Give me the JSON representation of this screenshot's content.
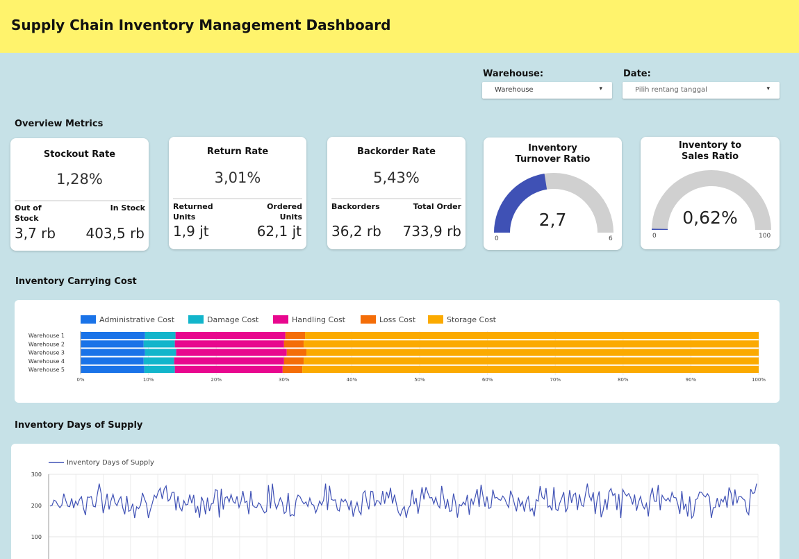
{
  "header": {
    "title": "Supply Chain Inventory Management Dashboard"
  },
  "filters": {
    "warehouse": {
      "label": "Warehouse:",
      "value": "Warehouse"
    },
    "date": {
      "label": "Date:",
      "placeholder": "Pilih rentang tanggal"
    }
  },
  "sections": {
    "overview": "Overview Metrics",
    "carrying": "Inventory Carrying Cost",
    "days": "Inventory Days of Supply"
  },
  "metrics": {
    "stockout": {
      "title": "Stockout Rate",
      "value": "1,28%",
      "left_label": "Out of Stock",
      "left_value": "3,7 rb",
      "right_label": "In Stock",
      "right_value": "403,5 rb"
    },
    "return": {
      "title": "Return Rate",
      "value": "3,01%",
      "left_label": "Returned Units",
      "left_value": "1,9 jt",
      "right_label": "Ordered Units",
      "right_value": "62,1 jt"
    },
    "backorder": {
      "title": "Backorder Rate",
      "value": "5,43%",
      "left_label": "Backorders",
      "left_value": "36,2 rb",
      "right_label": "Total Order",
      "right_value": "733,9 rb"
    },
    "turnover": {
      "title_line1": "Inventory",
      "title_line2": "Turnover Ratio",
      "value": "2,7",
      "min": "0",
      "max": "6",
      "fraction": 0.45,
      "color": "#3f51b5"
    },
    "sales_ratio": {
      "title_line1": "Inventory to",
      "title_line2": "Sales Ratio",
      "value": "0,62%",
      "min": "0",
      "max": "100",
      "fraction": 0.0062,
      "color": "#3f51b5"
    }
  },
  "chart_data": [
    {
      "type": "bar",
      "orientation": "horizontal",
      "stacked": "percent",
      "categories": [
        "Warehouse 1",
        "Warehouse 2",
        "Warehouse 3",
        "Warehouse 4",
        "Warehouse 5"
      ],
      "series": [
        {
          "name": "Administrative Cost",
          "color": "#1a73e8",
          "values": [
            9.5,
            9.3,
            9.5,
            9.3,
            9.4
          ]
        },
        {
          "name": "Damage Cost",
          "color": "#12b5cb",
          "values": [
            4.5,
            4.6,
            4.6,
            4.5,
            4.5
          ]
        },
        {
          "name": "Handling Cost",
          "color": "#e8078e",
          "values": [
            16.2,
            16.1,
            16.3,
            16.2,
            15.9
          ]
        },
        {
          "name": "Loss Cost",
          "color": "#f46d08",
          "values": [
            2.9,
            2.9,
            2.9,
            2.9,
            2.9
          ]
        },
        {
          "name": "Storage Cost",
          "color": "#fbaa00",
          "values": [
            66.9,
            67.1,
            66.7,
            67.1,
            67.3
          ]
        }
      ],
      "x_ticks": [
        "0%",
        "10%",
        "20%",
        "30%",
        "40%",
        "50%",
        "60%",
        "70%",
        "80%",
        "90%",
        "100%"
      ],
      "xlim": [
        0,
        100
      ],
      "legend": "top-left",
      "grid": true
    },
    {
      "type": "line",
      "series": [
        {
          "name": "Inventory Days of Supply",
          "color": "#3f51b5",
          "points": 360,
          "mean": 215,
          "range": [
            160,
            270
          ]
        }
      ],
      "y_ticks": [
        "300",
        "200",
        "100"
      ],
      "ylim": [
        0,
        300
      ],
      "legend": "top-left",
      "grid": true
    }
  ]
}
